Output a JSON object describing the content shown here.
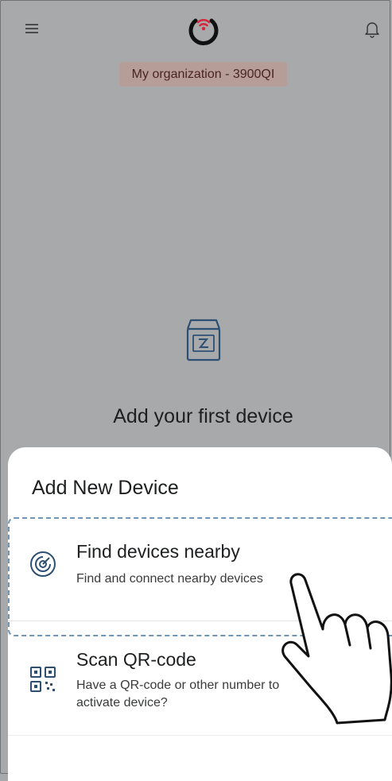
{
  "header": {
    "menu_icon": "hamburger-menu-icon",
    "logo_icon": "wifi-power-logo-icon",
    "notification_icon": "bell-icon",
    "organization_label": "My organization - 3900QI"
  },
  "main": {
    "empty_icon": "device-box-icon",
    "empty_title": "Add your first device"
  },
  "sheet": {
    "title": "Add New Device",
    "options": [
      {
        "icon": "radar-icon",
        "title": "Find devices nearby",
        "description": "Find and connect nearby devices"
      },
      {
        "icon": "qr-code-icon",
        "title": "Scan QR-code",
        "description_line1": "Have a QR-code or other number to",
        "description_line2": "activate device?"
      }
    ]
  },
  "overlay": {
    "pointer_icon": "pointing-hand-icon"
  },
  "colors": {
    "backdrop": "#a7a9aa",
    "badge_bg": "#b79d98",
    "brand_red": "#d6263a",
    "icon_blue": "#2d4f73",
    "dash_blue": "#6f96b9"
  }
}
